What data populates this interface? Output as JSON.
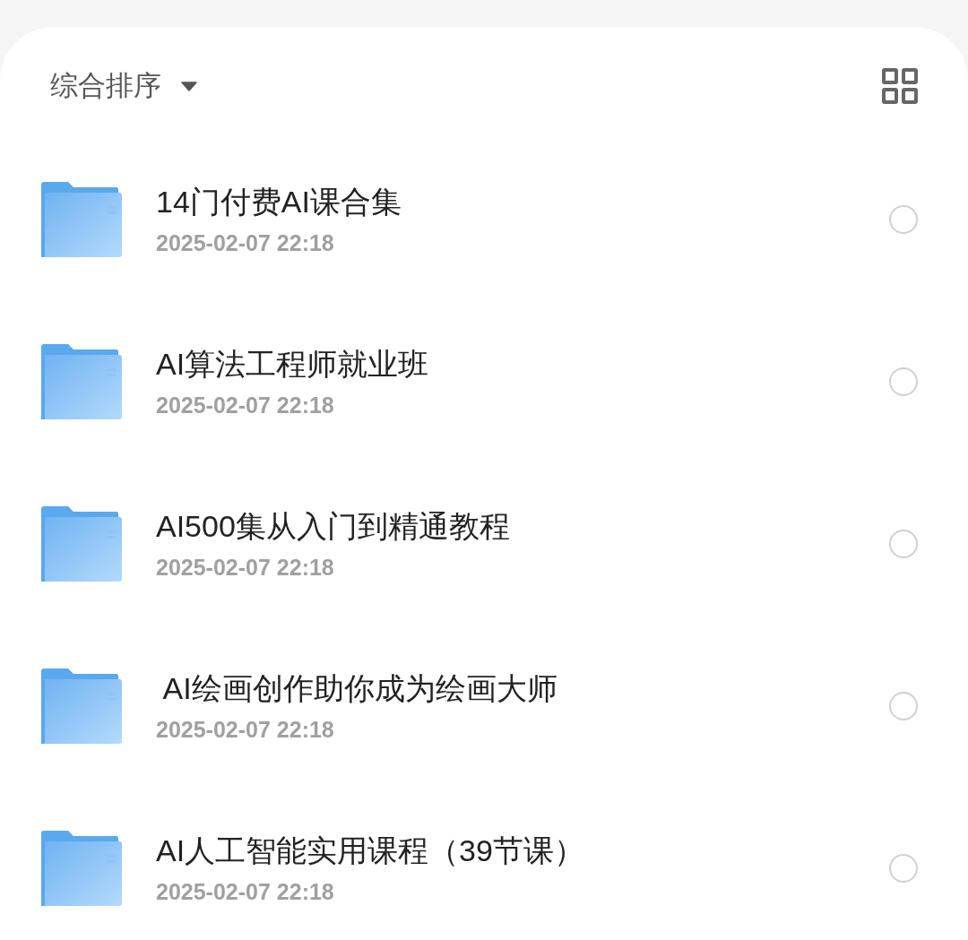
{
  "sort": {
    "label": "综合排序"
  },
  "folders": [
    {
      "name": "14门付费AI课合集",
      "date": "2025-02-07 22:18",
      "selected": false
    },
    {
      "name": "AI算法工程师就业班",
      "date": "2025-02-07 22:18",
      "selected": false
    },
    {
      "name": "AI500集从入门到精通教程",
      "date": "2025-02-07 22:18",
      "selected": false
    },
    {
      "name": " AI绘画创作助你成为绘画大师",
      "date": "2025-02-07 22:18",
      "selected": false
    },
    {
      "name": "AI人工智能实用课程（39节课）",
      "date": "2025-02-07 22:18",
      "selected": false
    }
  ]
}
